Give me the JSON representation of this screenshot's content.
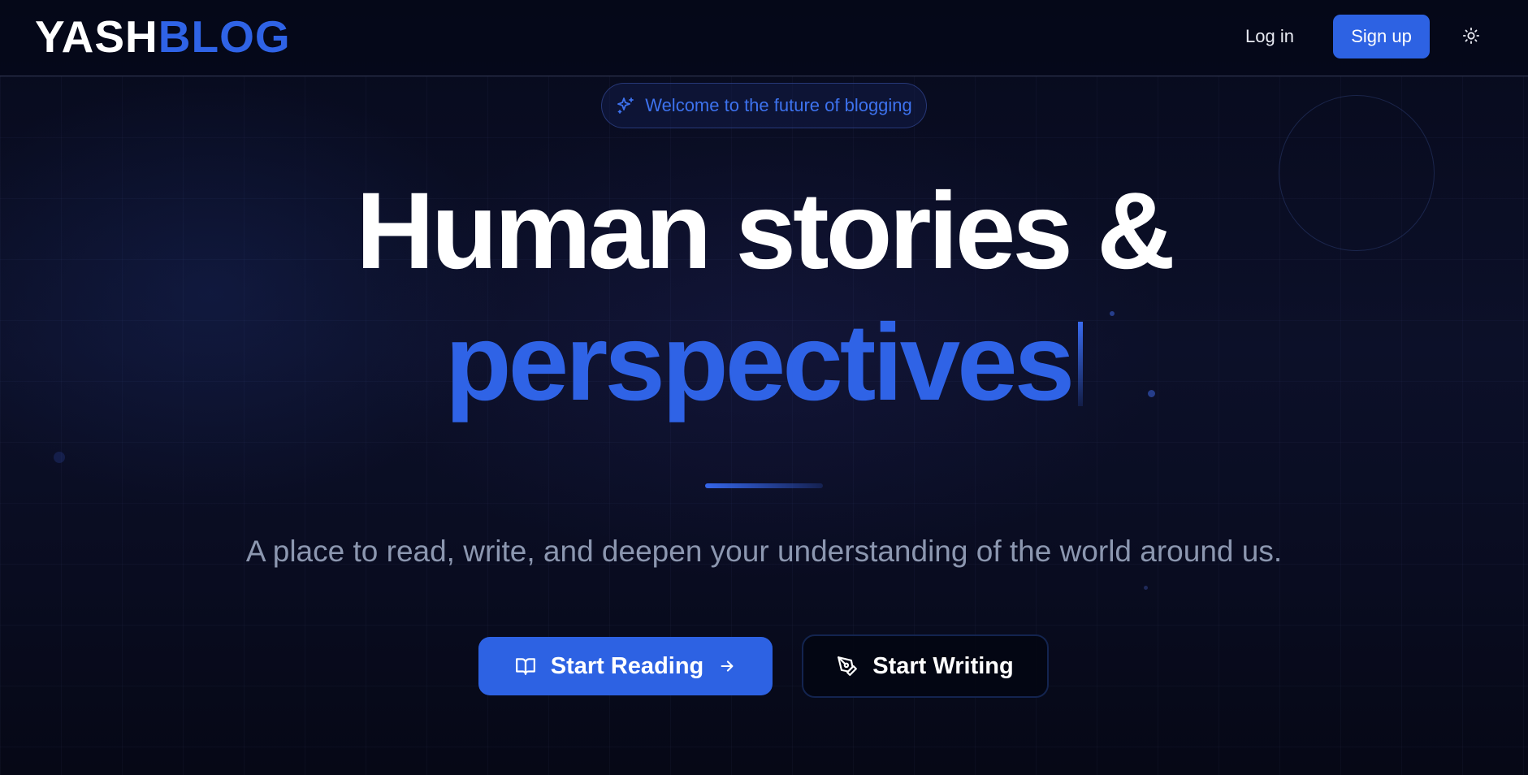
{
  "brand": {
    "part1": "YASH",
    "part2": "BLOG"
  },
  "header": {
    "login_label": "Log in",
    "signup_label": "Sign up",
    "theme_icon": "sun-icon"
  },
  "hero": {
    "badge_text": "Welcome to the future of blogging",
    "badge_icon": "sparkles-icon",
    "headline_line1": "Human stories &",
    "headline_line2": "perspectives",
    "subtitle": "A place to read, write, and deepen your understanding of the world around us."
  },
  "actions": {
    "read_label": "Start Reading",
    "read_icon": "book-open-icon",
    "read_trailing_icon": "arrow-right-icon",
    "write_label": "Start Writing",
    "write_icon": "pen-tool-icon"
  },
  "colors": {
    "accent": "#2f63e6",
    "background": "#070a1a",
    "subtitle": "#8c97b0"
  }
}
